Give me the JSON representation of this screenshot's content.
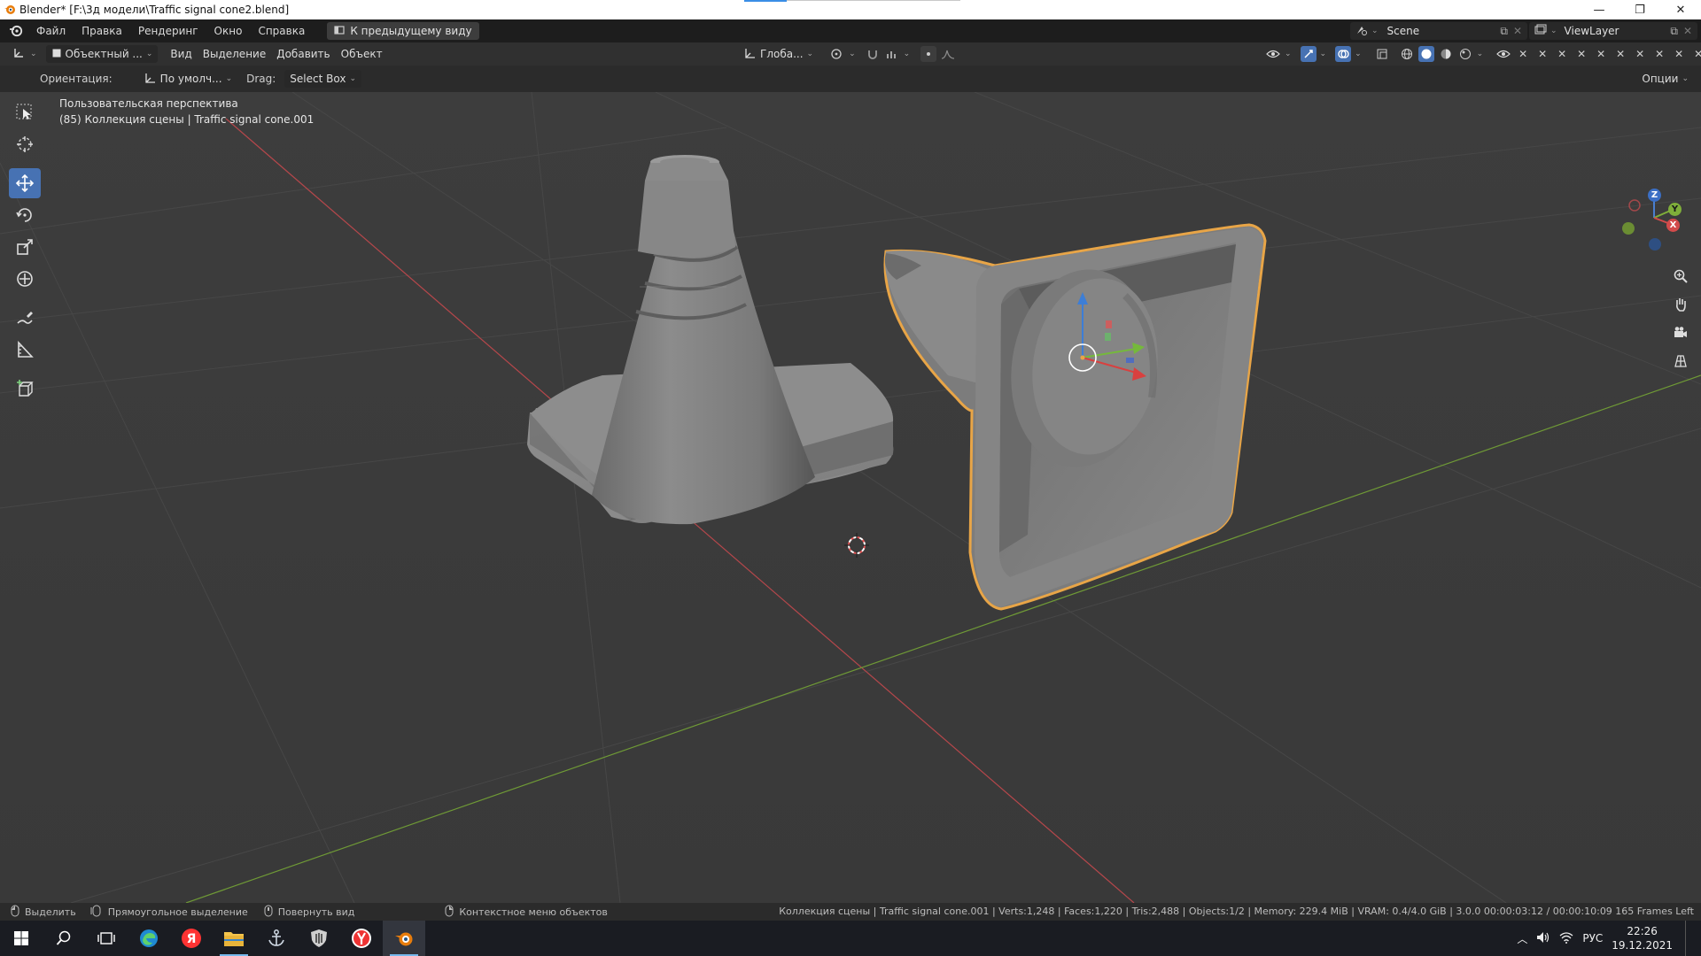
{
  "window": {
    "title": "Blender* [F:\\3д модели\\Traffic signal cone2.blend]",
    "controls": [
      "—",
      "❐",
      "✕"
    ]
  },
  "menu": {
    "items": [
      "Файл",
      "Правка",
      "Рендеринг",
      "Окно",
      "Справка"
    ],
    "prev_view_label": "К предыдущему виду",
    "scene_label": "Scene",
    "viewlayer_label": "ViewLayer"
  },
  "viewport_header": {
    "mode_label": "Объектный ...",
    "menus": [
      "Вид",
      "Выделение",
      "Добавить",
      "Объект"
    ],
    "transform_orientation": "Глоба...",
    "options_label": "Опции"
  },
  "tool_settings": {
    "orientation_label": "Ориентация:",
    "orientation_value": "По умолч...",
    "drag_label": "Drag:",
    "drag_value": "Select Box"
  },
  "viewport": {
    "view_name": "Пользовательская перспектива",
    "collection_info": "(85) Коллекция сцены | Traffic signal cone.001"
  },
  "gizmo": {
    "x": "X",
    "y": "Y",
    "z": "Z"
  },
  "statusbar": {
    "hint_select": "Выделить",
    "hint_box": "Прямоугольное выделение",
    "hint_rotate": "Повернуть вид",
    "hint_context": "Контекстное меню объектов",
    "stats": "Коллекция сцены | Traffic signal cone.001 | Verts:1,248 | Faces:1,220 | Tris:2,488 | Objects:1/2 | Memory: 229.4 MiB | VRAM: 0.4/4.0 GiB | 3.0.0  00:00:03:12 / 00:00:10:09 165 Frames Left"
  },
  "taskbar": {
    "lang": "РУС",
    "time": "22:26",
    "date": "19.12.2021"
  },
  "colors": {
    "selected_outline": "#e8a547",
    "x_axis": "#c8484c",
    "y_axis": "#7ea53a",
    "active_tool": "#4772b3"
  }
}
